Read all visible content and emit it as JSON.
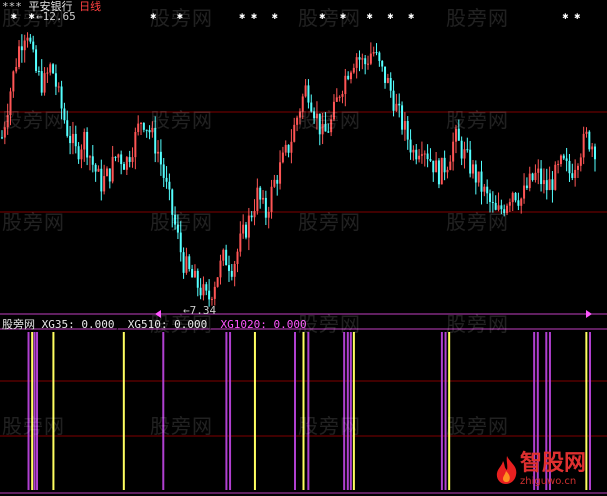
{
  "header": {
    "stock_name": "平安银行",
    "period": "日线",
    "high_label": "12.65",
    "low_label": "7.34"
  },
  "indicator": {
    "name": "股旁网",
    "items": [
      {
        "key": "XG35",
        "value": "0.000"
      },
      {
        "key": "XG510",
        "value": "0.000"
      },
      {
        "key": "XG1020",
        "value": "0.000"
      }
    ]
  },
  "watermark": "股旁网",
  "logo": {
    "text": "智股网",
    "url": "zhiguwo.cn"
  },
  "colors": {
    "background": "#000000",
    "up_candle": "#ff5555",
    "down_candle": "#54ffff",
    "grid": "#800000",
    "xg35": "#ffff60",
    "xg510": "#ffffff",
    "xg1020": "#ff55ff",
    "signal_purple": "#b040d0",
    "signal_yellow": "#ffff60"
  },
  "chart_data": [
    {
      "type": "candlestick",
      "price_range": [
        7.34,
        12.65
      ],
      "close_path": [
        10.5,
        11.4,
        12.2,
        12.65,
        11.8,
        11.5,
        11.9,
        11.2,
        10.6,
        10.2,
        10.5,
        10.0,
        9.6,
        9.8,
        10.2,
        10.0,
        10.4,
        10.9,
        10.6,
        10.2,
        9.5,
        8.8,
        8.1,
        7.8,
        7.6,
        7.34,
        7.8,
        8.2,
        8.0,
        8.5,
        8.9,
        9.4,
        9.0,
        9.6,
        10.0,
        10.4,
        11.0,
        11.5,
        11.0,
        10.5,
        10.8,
        11.4,
        11.8,
        12.1,
        11.9,
        12.2,
        11.8,
        11.5,
        11.0,
        10.6,
        10.2,
        10.4,
        10.1,
        9.8,
        10.0,
        10.5,
        10.2,
        9.9,
        9.6,
        9.3,
        9.0,
        9.2,
        9.5,
        9.3,
        9.6,
        9.8,
        9.5,
        9.7,
        10.0,
        9.8,
        10.2,
        10.5,
        10.3
      ],
      "star_markers_count": 14
    },
    {
      "type": "signal",
      "series": [
        {
          "name": "XG35",
          "value": 0.0
        },
        {
          "name": "XG510",
          "value": 0.0
        },
        {
          "name": "XG1020",
          "value": 0.0
        }
      ],
      "signal_bars": [
        {
          "color": "purple",
          "pos": 0.047
        },
        {
          "color": "yellow",
          "pos": 0.053
        },
        {
          "color": "purple",
          "pos": 0.057
        },
        {
          "color": "purple",
          "pos": 0.061
        },
        {
          "color": "yellow",
          "pos": 0.088
        },
        {
          "color": "yellow",
          "pos": 0.204
        },
        {
          "color": "purple",
          "pos": 0.269
        },
        {
          "color": "purple",
          "pos": 0.373
        },
        {
          "color": "purple",
          "pos": 0.379
        },
        {
          "color": "yellow",
          "pos": 0.42
        },
        {
          "color": "purple",
          "pos": 0.486
        },
        {
          "color": "yellow",
          "pos": 0.5
        },
        {
          "color": "purple",
          "pos": 0.508
        },
        {
          "color": "purple",
          "pos": 0.567
        },
        {
          "color": "purple",
          "pos": 0.573
        },
        {
          "color": "purple",
          "pos": 0.578
        },
        {
          "color": "yellow",
          "pos": 0.583
        },
        {
          "color": "purple",
          "pos": 0.728
        },
        {
          "color": "purple",
          "pos": 0.734
        },
        {
          "color": "yellow",
          "pos": 0.74
        },
        {
          "color": "purple",
          "pos": 0.88
        },
        {
          "color": "purple",
          "pos": 0.886
        },
        {
          "color": "purple",
          "pos": 0.9
        },
        {
          "color": "purple",
          "pos": 0.906
        },
        {
          "color": "yellow",
          "pos": 0.966
        },
        {
          "color": "purple",
          "pos": 0.972
        }
      ]
    }
  ]
}
